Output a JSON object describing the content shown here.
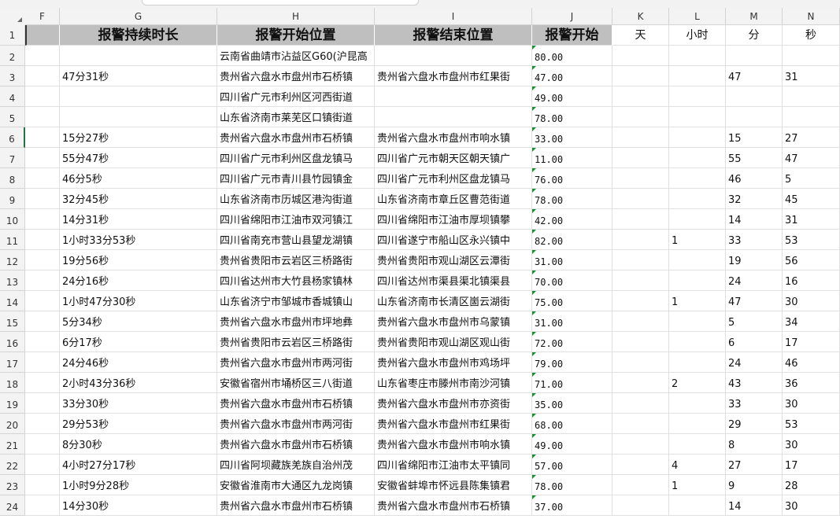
{
  "columns": [
    "F",
    "G",
    "H",
    "I",
    "J",
    "K",
    "L",
    "M",
    "N"
  ],
  "header_row": {
    "row_number": "1",
    "labels": [
      "",
      "报警持续时长",
      "报警开始位置",
      "报警结束位置",
      "报警开始",
      "天",
      "小时",
      "分",
      "秒"
    ]
  },
  "rows": [
    {
      "n": "2",
      "g": "",
      "h": "云南省曲靖市沾益区G60(沪昆高",
      "i": "",
      "j": "80.00",
      "k": "",
      "l": "",
      "m": "",
      "s": ""
    },
    {
      "n": "3",
      "g": "47分31秒",
      "h": "贵州省六盘水市盘州市石桥镇",
      "i": "贵州省六盘水市盘州市红果街",
      "j": "47.00",
      "k": "",
      "l": "",
      "m": "47",
      "s": "31"
    },
    {
      "n": "4",
      "g": "",
      "h": "四川省广元市利州区河西街道",
      "i": "",
      "j": "49.00",
      "k": "",
      "l": "",
      "m": "",
      "s": ""
    },
    {
      "n": "5",
      "g": "",
      "h": "山东省济南市莱芜区口镇街道",
      "i": "",
      "j": "78.00",
      "k": "",
      "l": "",
      "m": "",
      "s": ""
    },
    {
      "n": "6",
      "g": "15分27秒",
      "h": "贵州省六盘水市盘州市石桥镇",
      "i": "贵州省六盘水市盘州市响水镇",
      "j": "33.00",
      "k": "",
      "l": "",
      "m": "15",
      "s": "27"
    },
    {
      "n": "7",
      "g": "55分47秒",
      "h": "四川省广元市利州区盘龙镇马",
      "i": "四川省广元市朝天区朝天镇广",
      "j": "11.00",
      "k": "",
      "l": "",
      "m": "55",
      "s": "47"
    },
    {
      "n": "8",
      "g": "46分5秒",
      "h": "四川省广元市青川县竹园镇金",
      "i": "四川省广元市利州区盘龙镇马",
      "j": "76.00",
      "k": "",
      "l": "",
      "m": "46",
      "s": "5"
    },
    {
      "n": "9",
      "g": "32分45秒",
      "h": "山东省济南市历城区港沟街道",
      "i": "山东省济南市章丘区曹范街道",
      "j": "78.00",
      "k": "",
      "l": "",
      "m": "32",
      "s": "45"
    },
    {
      "n": "10",
      "g": "14分31秒",
      "h": "四川省绵阳市江油市双河镇江",
      "i": "四川省绵阳市江油市厚坝镇攀",
      "j": "42.00",
      "k": "",
      "l": "",
      "m": "14",
      "s": "31"
    },
    {
      "n": "11",
      "g": "1小时33分53秒",
      "h": "四川省南充市营山县望龙湖镇",
      "i": "四川省遂宁市船山区永兴镇中",
      "j": "82.00",
      "k": "",
      "l": "1",
      "m": "33",
      "s": "53"
    },
    {
      "n": "12",
      "g": "19分56秒",
      "h": "贵州省贵阳市云岩区三桥路街",
      "i": "贵州省贵阳市观山湖区云潭街",
      "j": "31.00",
      "k": "",
      "l": "",
      "m": "19",
      "s": "56"
    },
    {
      "n": "13",
      "g": "24分16秒",
      "h": "四川省达州市大竹县杨家镇林",
      "i": "四川省达州市渠县渠北镇渠县",
      "j": "70.00",
      "k": "",
      "l": "",
      "m": "24",
      "s": "16"
    },
    {
      "n": "14",
      "g": "1小时47分30秒",
      "h": "山东省济宁市邹城市香城镇山",
      "i": "山东省济南市长清区崮云湖街",
      "j": "75.00",
      "k": "",
      "l": "1",
      "m": "47",
      "s": "30"
    },
    {
      "n": "15",
      "g": "5分34秒",
      "h": "贵州省六盘水市盘州市坪地彝",
      "i": "贵州省六盘水市盘州市乌蒙镇",
      "j": "31.00",
      "k": "",
      "l": "",
      "m": "5",
      "s": "34"
    },
    {
      "n": "16",
      "g": "6分17秒",
      "h": "贵州省贵阳市云岩区三桥路街",
      "i": "贵州省贵阳市观山湖区观山街",
      "j": "72.00",
      "k": "",
      "l": "",
      "m": "6",
      "s": "17"
    },
    {
      "n": "17",
      "g": "24分46秒",
      "h": "贵州省六盘水市盘州市两河街",
      "i": "贵州省六盘水市盘州市鸡场坪",
      "j": "79.00",
      "k": "",
      "l": "",
      "m": "24",
      "s": "46"
    },
    {
      "n": "18",
      "g": "2小时43分36秒",
      "h": "安徽省宿州市埇桥区三八街道",
      "i": "山东省枣庄市滕州市南沙河镇",
      "j": "71.00",
      "k": "",
      "l": "2",
      "m": "43",
      "s": "36"
    },
    {
      "n": "19",
      "g": "33分30秒",
      "h": "贵州省六盘水市盘州市石桥镇",
      "i": "贵州省六盘水市盘州市亦资街",
      "j": "35.00",
      "k": "",
      "l": "",
      "m": "33",
      "s": "30"
    },
    {
      "n": "20",
      "g": "29分53秒",
      "h": "贵州省六盘水市盘州市两河街",
      "i": "贵州省六盘水市盘州市红果街",
      "j": "68.00",
      "k": "",
      "l": "",
      "m": "29",
      "s": "53"
    },
    {
      "n": "21",
      "g": "8分30秒",
      "h": "贵州省六盘水市盘州市石桥镇",
      "i": "贵州省六盘水市盘州市响水镇",
      "j": "49.00",
      "k": "",
      "l": "",
      "m": "8",
      "s": "30"
    },
    {
      "n": "22",
      "g": "4小时27分17秒",
      "h": "四川省阿坝藏族羌族自治州茂",
      "i": "四川省绵阳市江油市太平镇同",
      "j": "57.00",
      "k": "",
      "l": "4",
      "m": "27",
      "s": "17"
    },
    {
      "n": "23",
      "g": "1小时9分28秒",
      "h": "安徽省淮南市大通区九龙岗镇",
      "i": "安徽省蚌埠市怀远县陈集镇君",
      "j": "78.00",
      "k": "",
      "l": "1",
      "m": "9",
      "s": "28"
    },
    {
      "n": "24",
      "g": "14分30秒",
      "h": "贵州省六盘水市盘州市石桥镇",
      "i": "贵州省六盘水市盘州市石桥镇",
      "j": "37.00",
      "k": "",
      "l": "",
      "m": "14",
      "s": "30"
    }
  ],
  "active_row": "6",
  "colors": {
    "header_fill": "#bfbfbf",
    "grid": "#e1e1e1",
    "error_triangle": "#1f8a3a",
    "row_highlight": "#217346"
  }
}
